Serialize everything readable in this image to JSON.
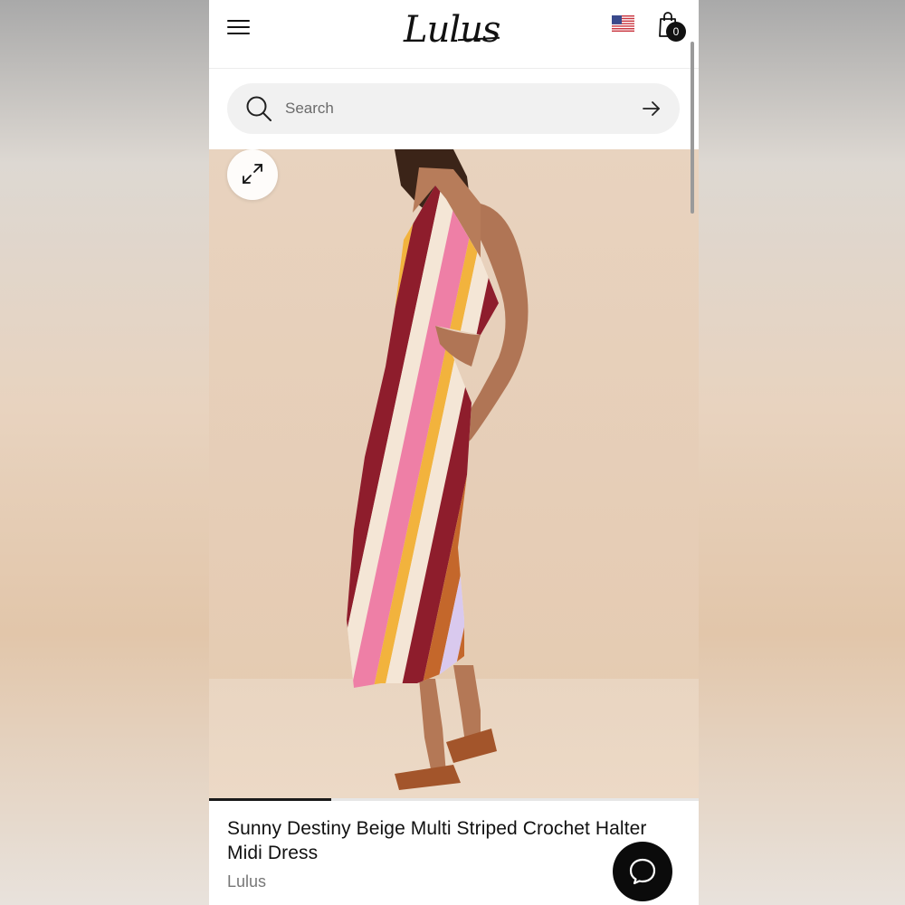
{
  "header": {
    "menu_icon": "hamburger-menu-icon",
    "logo": "Lulus",
    "flag_icon": "us-flag-icon",
    "cart_icon": "shopping-bag-icon",
    "cart_count": "0"
  },
  "search": {
    "placeholder": "Search",
    "icon": "search-icon",
    "submit_icon": "arrow-right-icon"
  },
  "gallery": {
    "expand_icon": "expand-icon",
    "progress": 0.25
  },
  "product": {
    "title": "Sunny Destiny Beige Multi Striped Crochet Halter Midi Dress",
    "brand": "Lulus"
  },
  "chat": {
    "icon": "chat-bubble-icon"
  },
  "colors": {
    "stripe_burgundy": "#8e1d2c",
    "stripe_pink": "#ee7fa6",
    "stripe_cream": "#f4e6d6",
    "stripe_orange": "#c4672b",
    "stripe_yellow": "#f2b33d",
    "stripe_lilac": "#d9c9ee"
  }
}
